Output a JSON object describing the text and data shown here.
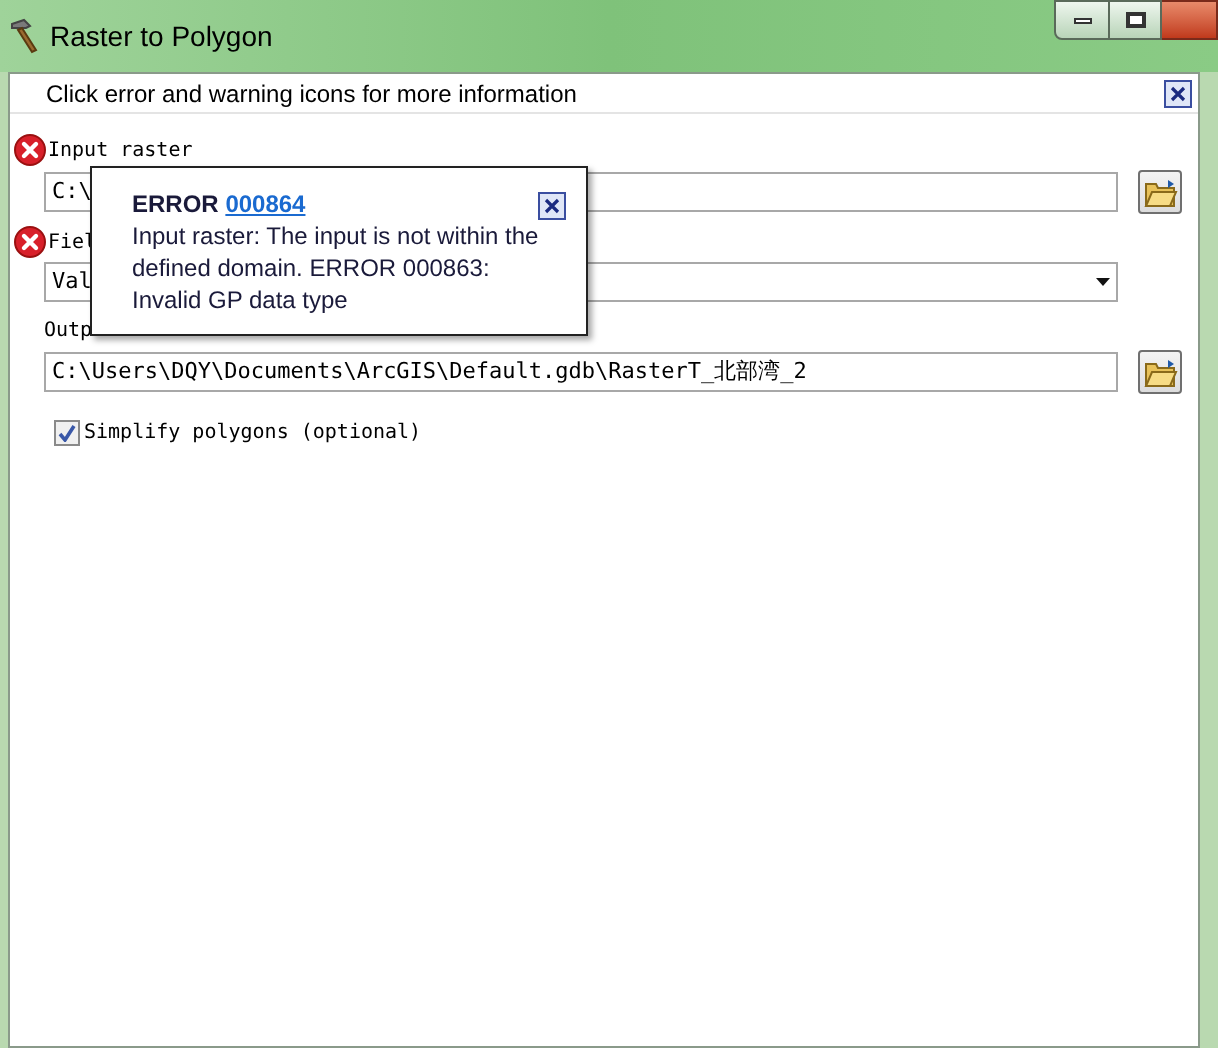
{
  "window": {
    "title": "Raster to Polygon"
  },
  "info_bar": {
    "text": "Click error and warning icons for more information"
  },
  "parameters": [
    {
      "kind": "file",
      "label": "Input raster",
      "error": true,
      "value": "C:\\"
    },
    {
      "kind": "dropdown",
      "label": "Fiel",
      "error": true,
      "value": "Val"
    },
    {
      "kind": "file",
      "label": "Outp",
      "error": false,
      "value": "C:\\Users\\DQY\\Documents\\ArcGIS\\Default.gdb\\RasterT_北部湾_2"
    },
    {
      "kind": "checkbox",
      "label": "Simplify polygons (optional)",
      "checked": true
    }
  ],
  "popup": {
    "title": "ERROR",
    "code": "000864",
    "message": "Input raster: The input is not within the defined domain. ERROR 000863: Invalid GP data type"
  }
}
